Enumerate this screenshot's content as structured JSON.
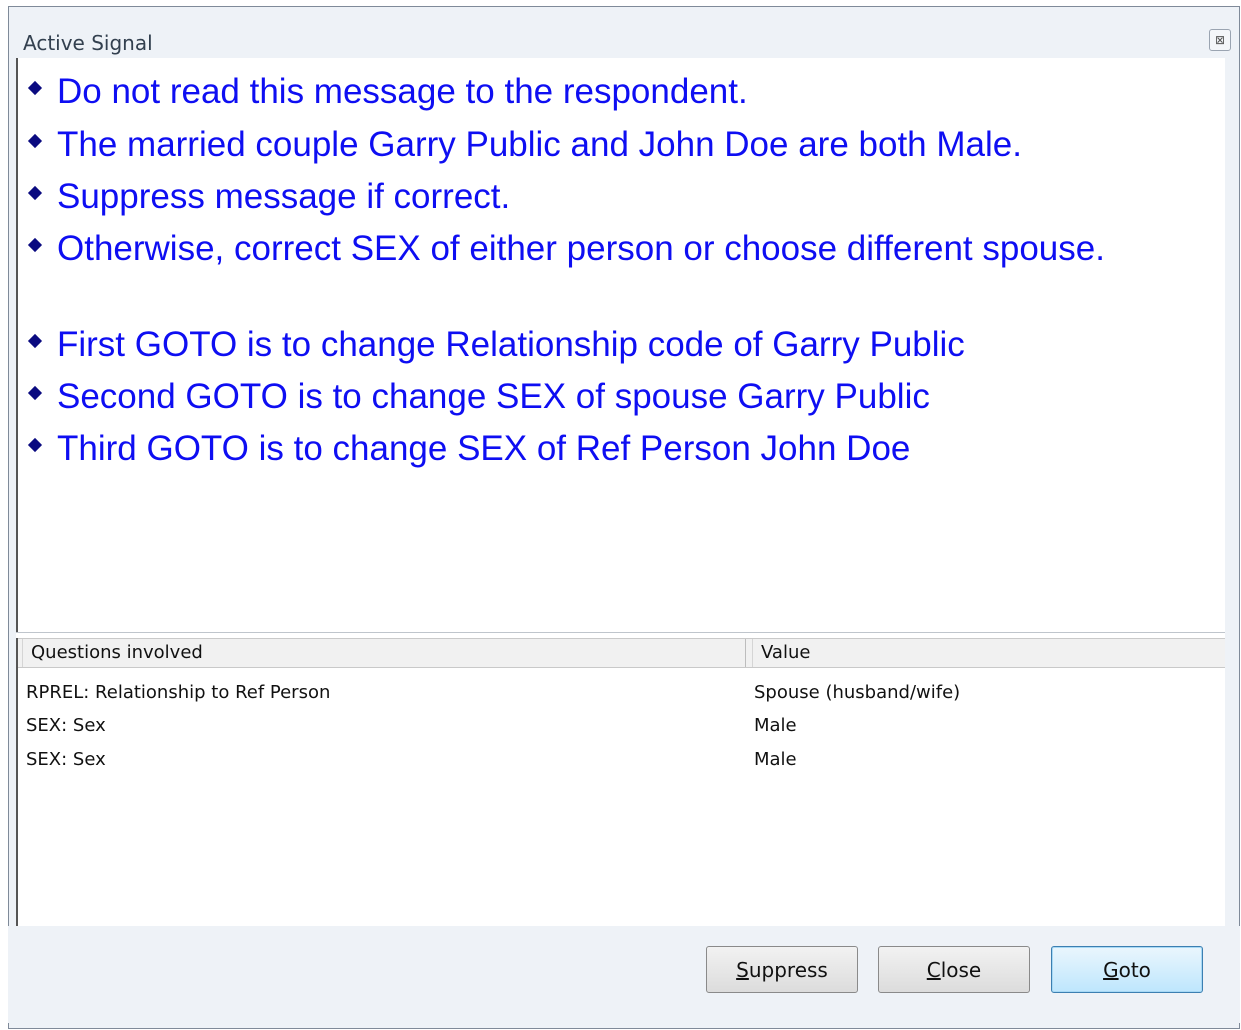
{
  "window": {
    "title": "Active Signal",
    "close_glyph": "⊠"
  },
  "message": {
    "lines": [
      "Do not read this message to the respondent.",
      "The married couple Garry Public and John Doe are both Male.",
      "Suppress message if correct.",
      "Otherwise, correct SEX of either person or choose different spouse.",
      "First GOTO is to change Relationship code of Garry Public",
      "Second GOTO is to change SEX of spouse Garry Public",
      "Third GOTO is to change SEX of Ref Person John Doe"
    ],
    "color": "#0e0ef2"
  },
  "grid": {
    "headers": [
      "Questions involved",
      "Value"
    ],
    "rows": [
      {
        "question": "RPREL: Relationship to Ref Person",
        "value": "Spouse (husband/wife)"
      },
      {
        "question": "SEX: Sex",
        "value": "Male"
      },
      {
        "question": "SEX: Sex",
        "value": "Male"
      }
    ]
  },
  "buttons": {
    "suppress": {
      "first": "S",
      "rest": "uppress"
    },
    "close": {
      "first": "C",
      "rest": "lose"
    },
    "goto": {
      "first": "G",
      "rest": "oto"
    }
  }
}
